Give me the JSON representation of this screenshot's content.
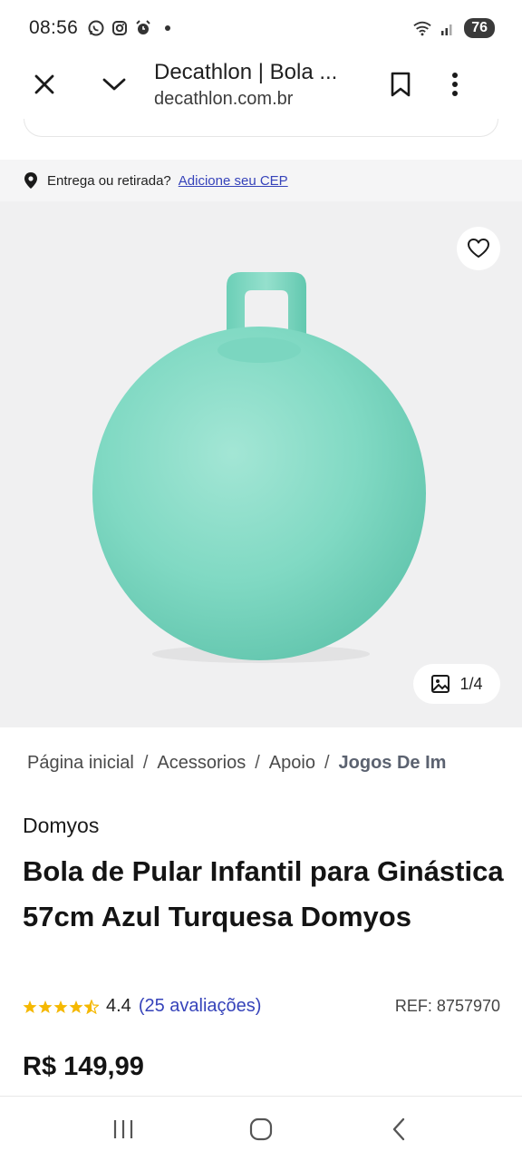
{
  "status_bar": {
    "time": "08:56",
    "battery": "76",
    "icons": [
      "whatsapp-icon",
      "instagram-icon",
      "alarm-icon",
      "wifi-icon",
      "signal-icon"
    ]
  },
  "browser": {
    "title": "Decathlon | Bola ...",
    "url": "decathlon.com.br"
  },
  "delivery": {
    "label": "Entrega ou retirada?",
    "link": "Adicione seu CEP"
  },
  "gallery": {
    "counter": "1/4"
  },
  "breadcrumb": {
    "items": [
      "Página inicial",
      "Acessorios",
      "Apoio",
      "Jogos De Im"
    ],
    "separator": "/"
  },
  "product": {
    "brand": "Domyos",
    "title": "Bola de Pular Infantil para Ginástica 57cm Azul Turquesa Domyos",
    "rating": "4.4",
    "rating_fraction": 0.88,
    "reviews": "(25 avaliações)",
    "ref": "REF: 8757970",
    "price": "R$ 149,99"
  },
  "colors": {
    "accent": "#3643ba",
    "star": "#f5b800",
    "ball": "#7fd8c4"
  }
}
